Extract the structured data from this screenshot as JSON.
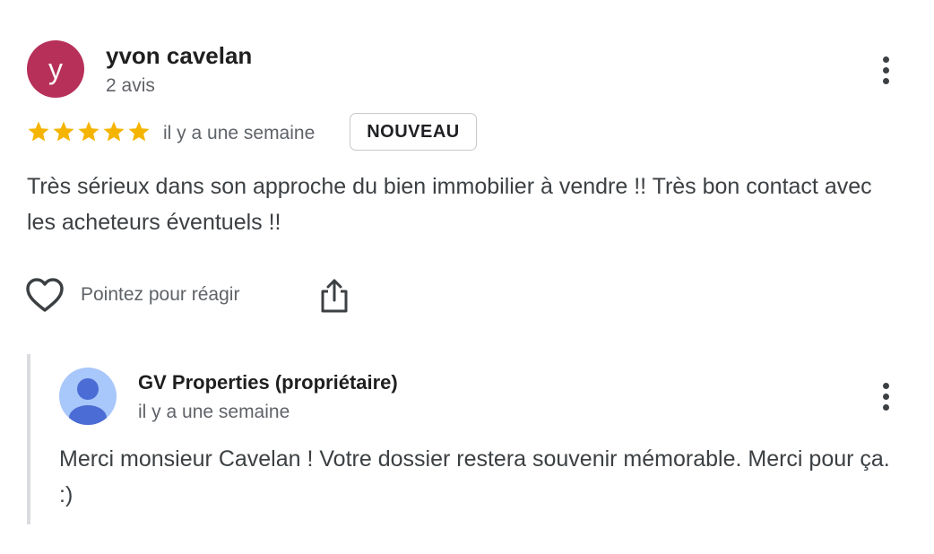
{
  "review": {
    "author": {
      "initial": "y",
      "name": "yvon cavelan",
      "meta": "2 avis",
      "avatar_color": "#b7305a"
    },
    "rating": 5,
    "rating_max": 5,
    "star_color": "#f4b400",
    "date": "il y a une semaine",
    "badge": "NOUVEAU",
    "text": "Très sérieux dans son approche du bien immobilier à vendre !! Très bon contact avec les acheteurs éventuels !!",
    "actions": {
      "react_icon": "heart-icon",
      "react_label": "Pointez pour réagir",
      "share_icon": "share-icon"
    },
    "more_icon": "more-vertical-icon"
  },
  "reply": {
    "owner_name": "GV Properties (propriétaire)",
    "date": "il y a une semaine",
    "text": "Merci monsieur Cavelan ! Votre dossier restera souvenir mémorable. Merci pour ça. :)",
    "avatar_icon": "person-avatar-icon",
    "more_icon": "more-vertical-icon"
  }
}
